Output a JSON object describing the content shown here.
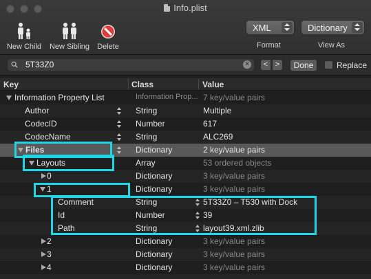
{
  "window": {
    "title": "Info.plist"
  },
  "toolbar": {
    "new_child": "New Child",
    "new_sibling": "New Sibling",
    "delete": "Delete",
    "format_value": "XML",
    "format_label": "Format",
    "view_as_value": "Dictionary",
    "view_as_label": "View As"
  },
  "search": {
    "query": "5T33Z0",
    "prev": "<",
    "next": ">",
    "done": "Done",
    "replace_label": "Replace"
  },
  "columns": {
    "key": "Key",
    "class": "Class",
    "value": "Value"
  },
  "rows": [
    {
      "key": "Information Property List",
      "class": "Information Prop...",
      "value": "7 key/value pairs"
    },
    {
      "key": "Author",
      "class": "String",
      "value": "Multiple"
    },
    {
      "key": "CodecID",
      "class": "Number",
      "value": "617"
    },
    {
      "key": "CodecName",
      "class": "String",
      "value": "ALC269"
    },
    {
      "key": "Files",
      "class": "Dictionary",
      "value": "2 key/value pairs"
    },
    {
      "key": "Layouts",
      "class": "Array",
      "value": "53 ordered objects"
    },
    {
      "key": "0",
      "class": "Dictionary",
      "value": "3 key/value pairs"
    },
    {
      "key": "1",
      "class": "Dictionary",
      "value": "3 key/value pairs"
    },
    {
      "key": "Comment",
      "class": "String",
      "value": "5T33Z0 – T530 with Dock"
    },
    {
      "key": "Id",
      "class": "Number",
      "value": "39"
    },
    {
      "key": "Path",
      "class": "String",
      "value": "layout39.xml.zlib"
    },
    {
      "key": "2",
      "class": "Dictionary",
      "value": "3 key/value pairs"
    },
    {
      "key": "3",
      "class": "Dictionary",
      "value": "3 key/value pairs"
    },
    {
      "key": "4",
      "class": "Dictionary",
      "value": "3 key/value pairs"
    }
  ],
  "colors": {
    "highlight": "#1fd6e6",
    "selection": "#595959"
  }
}
